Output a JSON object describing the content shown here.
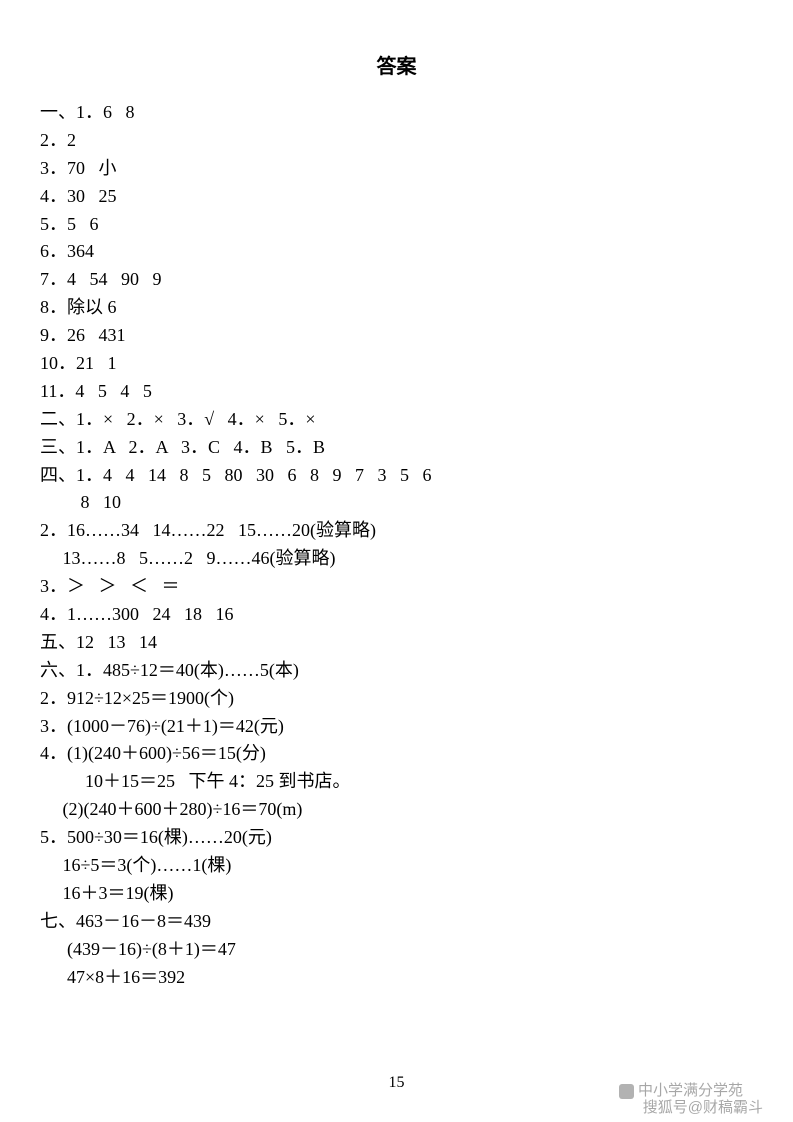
{
  "title": "答案",
  "lines": [
    "一、1．6   8",
    "2．2",
    "3．70   小",
    "4．30   25",
    "5．5   6",
    "6．364",
    "7．4   54   90   9",
    "8．除以 6",
    "9．26   431",
    "10．21   1",
    "11．4   5   4   5",
    "二、1．×   2．×   3．√   4．×   5．×",
    "三、1．A   2．A   3．C   4．B   5．B",
    "四、1．4   4   14   8   5   80   30   6   8   9   7   3   5   6",
    "         8   10",
    "2．16……34   14……22   15……20(验算略)",
    "     13……8   5……2   9……46(验算略)",
    "3．＞   ＞   ＜   ＝",
    "4．1……300   24   18   16",
    "五、12   13   14",
    "六、1．485÷12＝40(本)……5(本)",
    "2．912÷12×25＝1900(个)",
    "3．(1000－76)÷(21＋1)＝42(元)",
    "4．(1)(240＋600)÷56＝15(分)",
    "          10＋15＝25   下午 4：25 到书店。",
    "     (2)(240＋600＋280)÷16＝70(m)",
    "5．500÷30＝16(棵)……20(元)",
    "     16÷5＝3(个)……1(棵)",
    "     16＋3＝19(棵)",
    "七、463－16－8＝439",
    "      (439－16)÷(8＋1)＝47",
    "      47×8＋16＝392"
  ],
  "page_number": "15",
  "watermark1": "中小学满分学苑",
  "watermark2": "搜狐号@财稿霸斗"
}
